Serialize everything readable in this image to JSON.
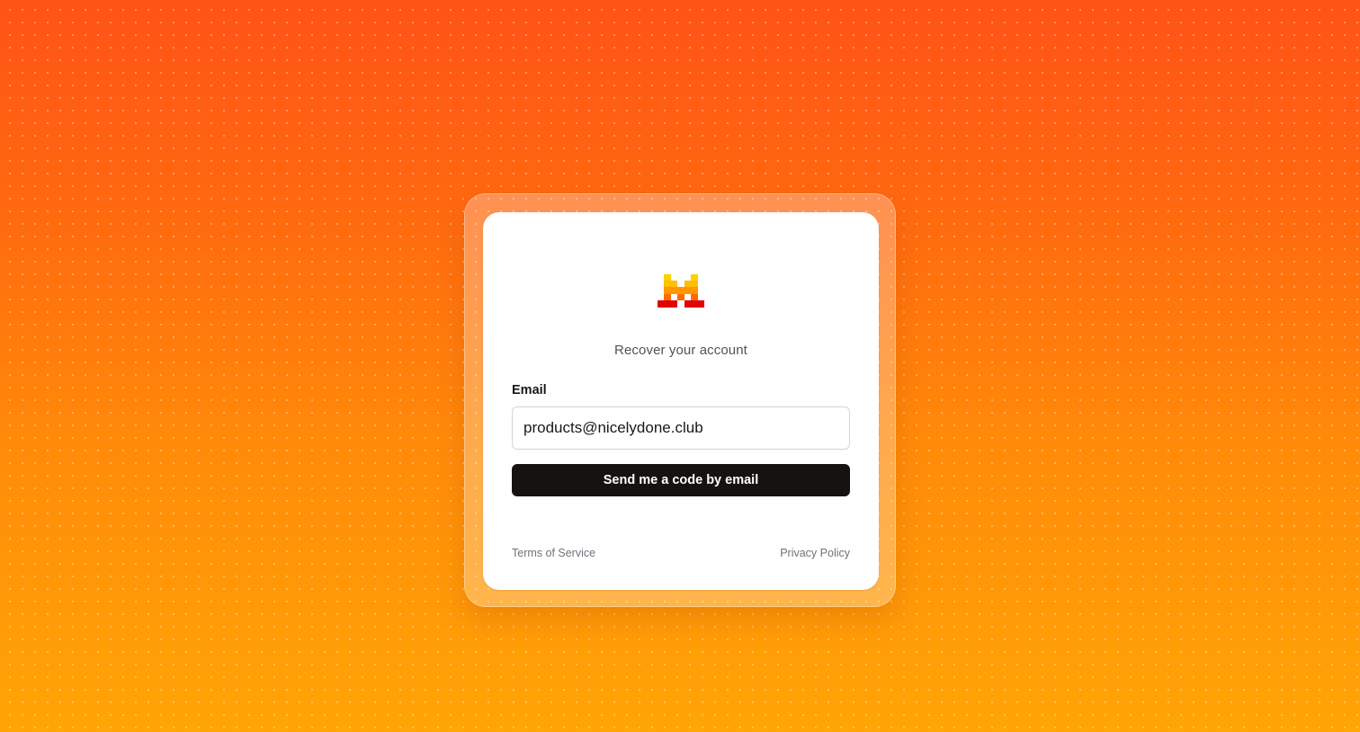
{
  "page": {
    "subtitle": "Recover your account",
    "colors": {
      "background_top": "#ff5316",
      "background_bottom": "#ffa505",
      "button": "#141312",
      "logo_yellow": "#ffd000",
      "logo_orange": "#ff8a00",
      "logo_red": "#e10500"
    }
  },
  "logo": {
    "icon": "pixel-m-logo-icon"
  },
  "form": {
    "email_label": "Email",
    "email_value": "products@nicelydone.club",
    "submit_label": "Send me a code by email"
  },
  "footer": {
    "terms_label": "Terms of Service",
    "privacy_label": "Privacy Policy"
  }
}
